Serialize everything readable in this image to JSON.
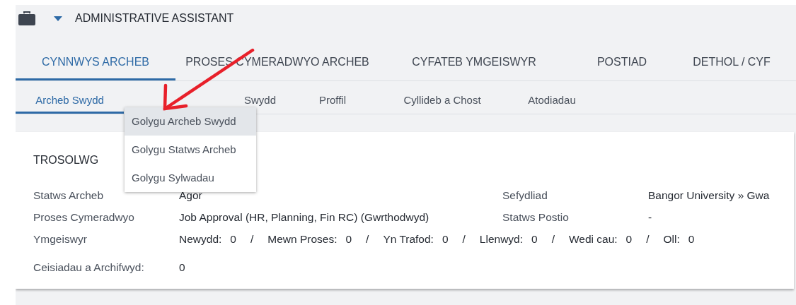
{
  "header": {
    "title": "ADMINISTRATIVE ASSISTANT"
  },
  "tabs": [
    {
      "label": "CYNNWYS ARCHEB",
      "selected": true
    },
    {
      "label": "PROSES CYMERADWYO ARCHEB",
      "selected": false
    },
    {
      "label": "CYFATEB YMGEISWYR",
      "selected": false
    },
    {
      "label": "POSTIAD",
      "selected": false
    },
    {
      "label": "DETHOL / CYF",
      "selected": false
    }
  ],
  "subtabs": [
    {
      "label": "Archeb Swydd",
      "selected": true
    },
    {
      "label": "Swydd",
      "selected": false
    },
    {
      "label": "Proffil",
      "selected": false
    },
    {
      "label": "Cyllideb a Chost",
      "selected": false
    },
    {
      "label": "Atodiadau",
      "selected": false
    }
  ],
  "dropdown_menu": [
    {
      "label": "Golygu Archeb Swydd",
      "selected": true
    },
    {
      "label": "Golygu Statws Archeb",
      "selected": false
    },
    {
      "label": "Golygu Sylwadau",
      "selected": false
    }
  ],
  "overview": {
    "title": "TROSOLWG",
    "status": {
      "label": "Statws Archeb",
      "value": "Agor"
    },
    "approval_process": {
      "label": "Proses Cymeradwyo",
      "value": "Job Approval (HR, Planning, Fin RC) (Gwrthodwyd)"
    },
    "applicants": {
      "label": "Ymgeiswyr",
      "counts": [
        {
          "label": "Newydd:",
          "value": "0",
          "separator": "/"
        },
        {
          "label": "Mewn Proses:",
          "value": "0",
          "separator": "/"
        },
        {
          "label": "Yn Trafod:",
          "value": "0",
          "separator": "/"
        },
        {
          "label": "Llenwyd:",
          "value": "0",
          "separator": "/"
        },
        {
          "label": "Wedi cau:",
          "value": "0",
          "separator": "/"
        },
        {
          "label": "Oll:",
          "value": "0"
        }
      ]
    },
    "requests": {
      "label": "Ceisiadau a Archifwyd:",
      "value": "0"
    },
    "organisation": {
      "label": "Sefydliad",
      "value": "Bangor University  » Gwa"
    },
    "posting_status": {
      "label": "Statws Postio",
      "value": "-"
    }
  }
}
